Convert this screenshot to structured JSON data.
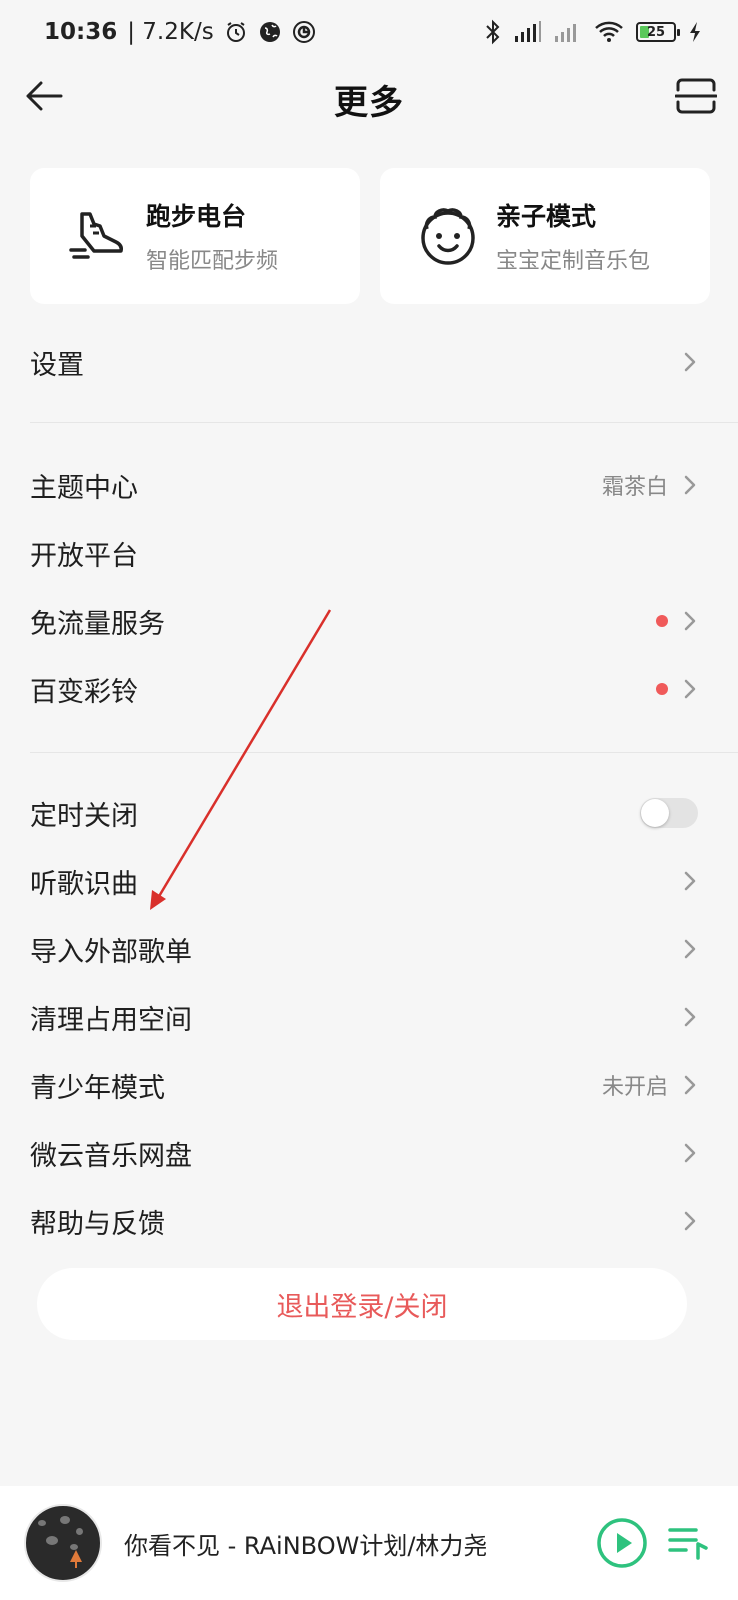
{
  "status_bar": {
    "time": "10:36",
    "speed": "| 7.2K/s",
    "battery": "25"
  },
  "header": {
    "title": "更多"
  },
  "cards": [
    {
      "title": "跑步电台",
      "subtitle": "智能匹配步频",
      "icon": "running-shoe-icon"
    },
    {
      "title": "亲子模式",
      "subtitle": "宝宝定制音乐包",
      "icon": "baby-face-icon"
    }
  ],
  "group1": [
    {
      "label": "设置"
    }
  ],
  "group2": [
    {
      "label": "主题中心",
      "value": "霜茶白"
    },
    {
      "label": "开放平台"
    },
    {
      "label": "免流量服务",
      "badge": true
    },
    {
      "label": "百变彩铃",
      "badge": true
    }
  ],
  "group3": [
    {
      "label": "定时关闭",
      "toggle": false
    },
    {
      "label": "听歌识曲"
    },
    {
      "label": "导入外部歌单"
    },
    {
      "label": "清理占用空间"
    },
    {
      "label": "青少年模式",
      "value": "未开启"
    },
    {
      "label": "微云音乐网盘"
    },
    {
      "label": "帮助与反馈"
    }
  ],
  "logout_label": "退出登录/关闭",
  "player": {
    "now_playing": "你看不见 - RAiNBOW计划/林力尧"
  },
  "colors": {
    "accent_red": "#e85a5a",
    "badge_red": "#f05a5a",
    "play_green": "#2ec27e",
    "annotation_red": "#d9302b"
  }
}
